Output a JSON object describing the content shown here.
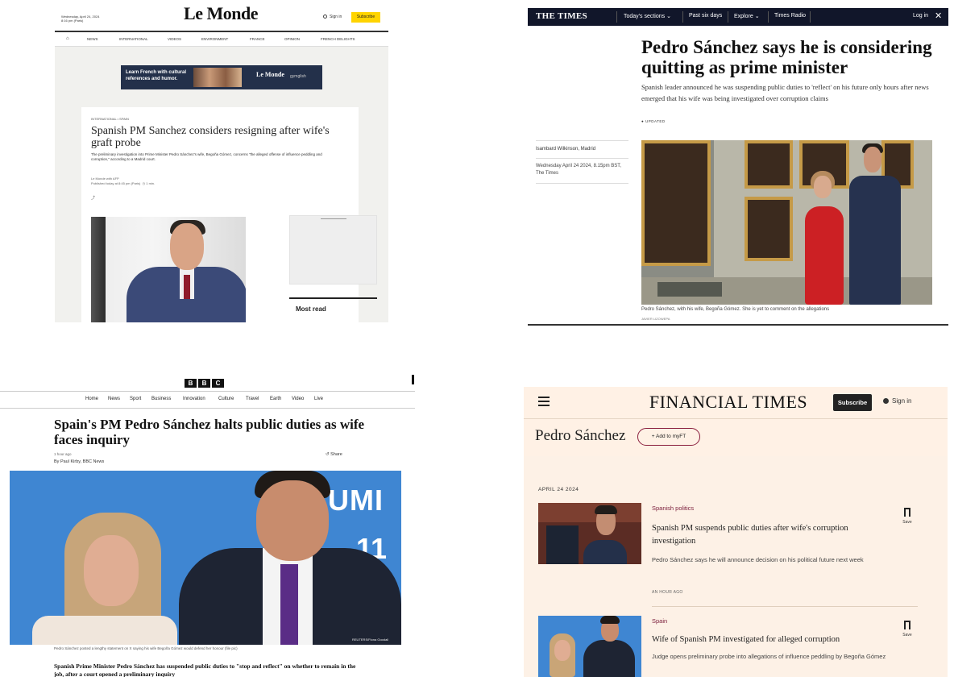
{
  "lemonde": {
    "date": "Wednesday, April 24, 2024",
    "location": "8:16 pm (Paris)",
    "logo": "Le Monde",
    "signin": "Sign in",
    "subscribe": "Subscribe",
    "nav": [
      "NEWS",
      "INTERNATIONAL",
      "VIDEOS",
      "ENVIRONMENT",
      "FRANCE",
      "OPINION",
      "FRENCH DELIGHTS"
    ],
    "ad_text": "Learn French with cultural references and humor.",
    "ad_logo": "Le Monde",
    "ad_tag": "gymglish",
    "kicker": "INTERNATIONAL  •  SPAIN",
    "headline": "Spanish PM Sanchez considers resigning after wife's graft probe",
    "standfirst": "The preliminary investigation into Prime Minister Pedro Sánchez's wife, Begoña Gómez, concerns \"the alleged offense of influence peddling and corruption,\" according to a Madrid court.",
    "byline": "Le Monde with AFP",
    "published": "Published today at 8:45 pm (Paris)",
    "read_time": "1 min.",
    "share": "⤴",
    "most_read": "Most read"
  },
  "times": {
    "logo": "THE TIMES",
    "nav": [
      "Today's sections",
      "Past six days",
      "Explore",
      "Times Radio"
    ],
    "login": "Log in",
    "close": "✕",
    "headline": "Pedro Sánchez says he is considering quitting as prime minister",
    "standfirst": "Spanish leader announced he was suspending public duties to 'reflect' on his future only hours after news emerged that his wife was being investigated over corruption claims",
    "updated": "● UPDATED",
    "author": "Isambard Wilkinson, Madrid",
    "date": "Wednesday April 24 2024, 8.15pm BST, The Times",
    "caption": "Pedro Sánchez, with his wife, Begoña Gómez. She is yet to comment on the allegations",
    "credit": "JAVIER LIZON/EPA"
  },
  "bbc": {
    "logo": [
      "B",
      "B",
      "C"
    ],
    "nav": [
      "Home",
      "News",
      "Sport",
      "Business",
      "Innovation",
      "Culture",
      "Travel",
      "Earth",
      "Video",
      "Live"
    ],
    "headline": "Spain's PM Pedro Sánchez halts public duties as wife faces inquiry",
    "time": "1 hour ago",
    "author": "By Paul Kirby, BBC News",
    "share": "Share",
    "photo_text_1": "UMI",
    "photo_text_2": "11",
    "photo_credit": "REUTERS/Fiona Goodall",
    "caption": "Pedro Sánchez posted a lengthy statement on X saying his wife Begoña Gómez would defend her honour (file pic)",
    "body": "Spanish Prime Minister Pedro Sánchez has suspended public duties to \"stop and reflect\" on whether to remain in the job, after a court opened a preliminary inquiry"
  },
  "ft": {
    "logo": "FINANCIAL TIMES",
    "subscribe": "Subscribe",
    "signin": "Sign in",
    "topic": "Pedro Sánchez",
    "add": "+ Add to myFT",
    "date": "APRIL 24 2024",
    "items": [
      {
        "category": "Spanish politics",
        "headline": "Spanish PM suspends public duties after wife's corruption investigation",
        "desc": "Pedro Sánchez says he will announce decision on his political future next week",
        "age": "AN HOUR AGO",
        "save": "Save"
      },
      {
        "category": "Spain",
        "headline": "Wife of Spanish PM investigated for alleged corruption",
        "desc": "Judge opens preliminary probe into allegations of influence peddling by Begoña Gómez",
        "save": "Save"
      }
    ]
  }
}
